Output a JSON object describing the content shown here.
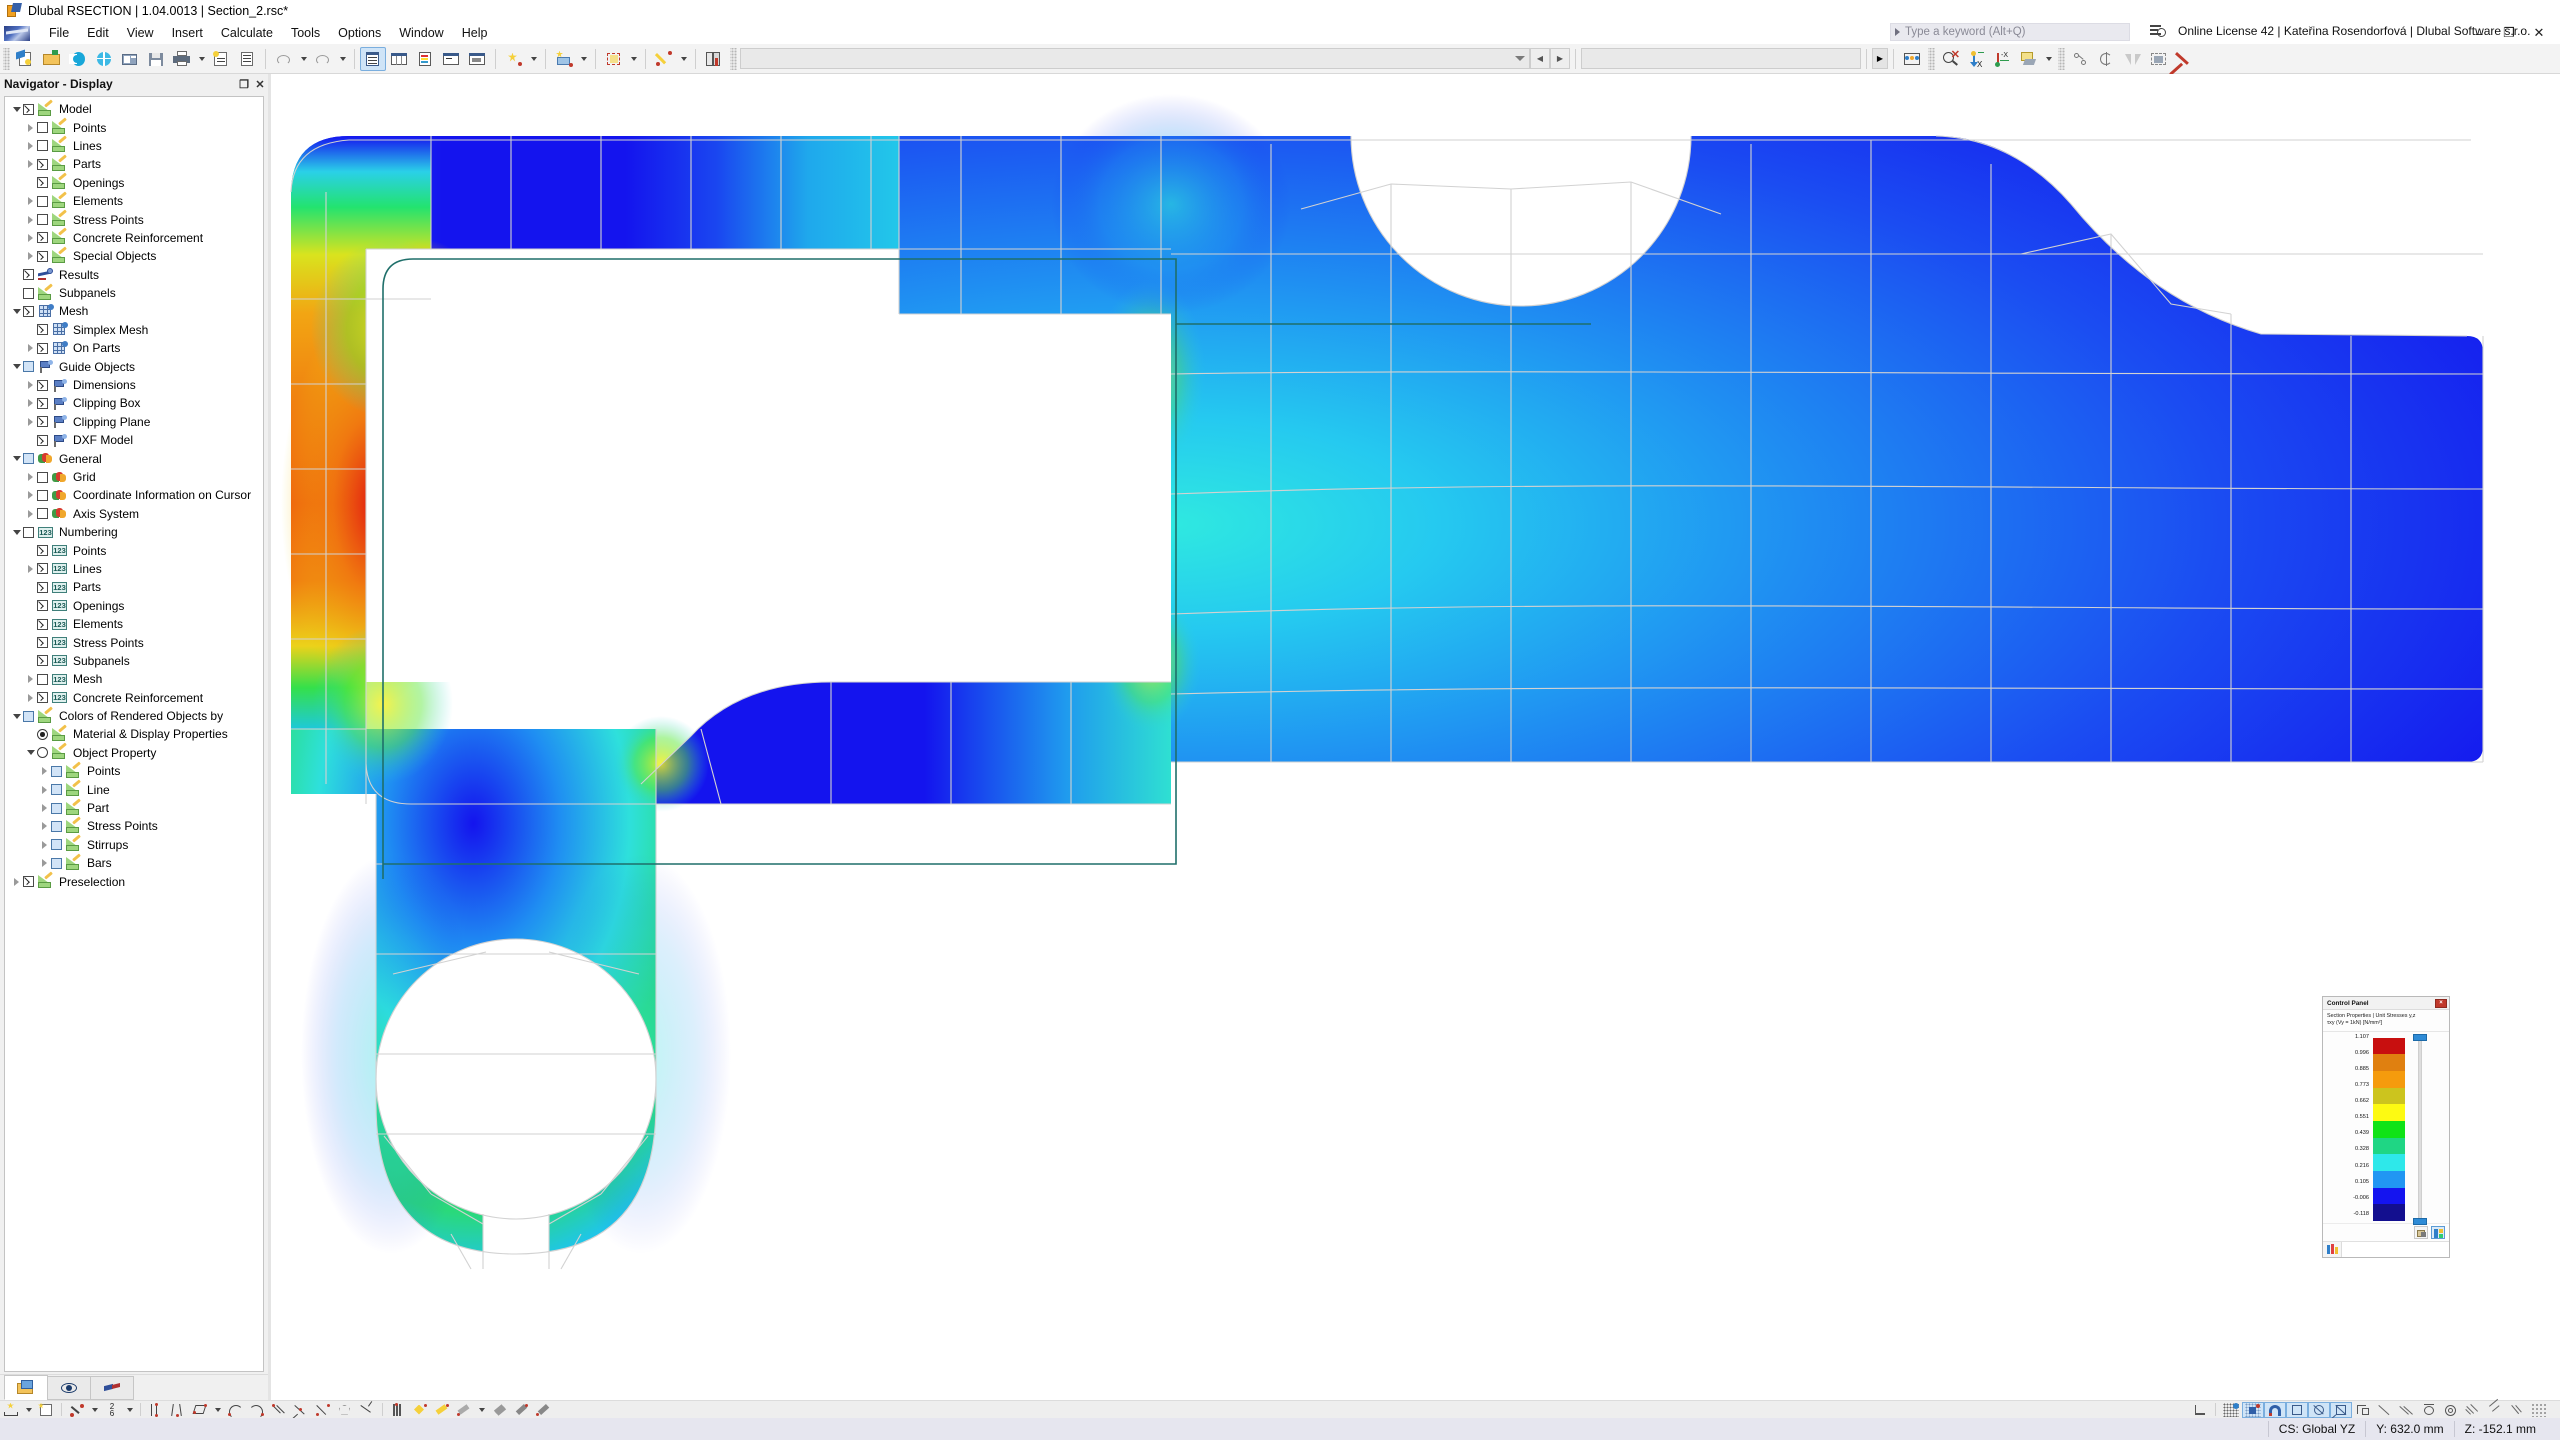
{
  "window": {
    "title": "Dlubal RSECTION | 1.04.0013 | Section_2.rsc*",
    "app_icon": "rsection-app-icon",
    "minimize": "–",
    "restore": "❐",
    "close": "✕"
  },
  "menu": {
    "logo": "dlubal-logo",
    "items": [
      {
        "label": "File"
      },
      {
        "label": "Edit"
      },
      {
        "label": "View"
      },
      {
        "label": "Insert"
      },
      {
        "label": "Calculate"
      },
      {
        "label": "Tools"
      },
      {
        "label": "Options"
      },
      {
        "label": "Window"
      },
      {
        "label": "Help"
      }
    ]
  },
  "search": {
    "placeholder": "Type a keyword (Alt+Q)",
    "value": ""
  },
  "license": {
    "text": "Online License 42 | Kateřina Rosendorfová | Dlubal Software s.r.o.",
    "icon": "license-list-search-icon"
  },
  "navigator": {
    "title": "Navigator - Display",
    "undock_label": "❐",
    "close_label": "✕",
    "tree": [
      {
        "label": "Model",
        "indent": 0,
        "chev": "down",
        "ctrl": "check-on",
        "icon": "ruler"
      },
      {
        "label": "Points",
        "indent": 1,
        "chev": "right",
        "ctrl": "check-off",
        "icon": "ruler"
      },
      {
        "label": "Lines",
        "indent": 1,
        "chev": "right",
        "ctrl": "check-off",
        "icon": "ruler"
      },
      {
        "label": "Parts",
        "indent": 1,
        "chev": "right",
        "ctrl": "check-on",
        "icon": "ruler"
      },
      {
        "label": "Openings",
        "indent": 1,
        "chev": "none",
        "ctrl": "check-on",
        "icon": "ruler"
      },
      {
        "label": "Elements",
        "indent": 1,
        "chev": "right",
        "ctrl": "check-off",
        "icon": "ruler"
      },
      {
        "label": "Stress Points",
        "indent": 1,
        "chev": "right",
        "ctrl": "check-off",
        "icon": "ruler"
      },
      {
        "label": "Concrete Reinforcement",
        "indent": 1,
        "chev": "right",
        "ctrl": "check-on",
        "icon": "ruler"
      },
      {
        "label": "Special Objects",
        "indent": 1,
        "chev": "right",
        "ctrl": "check-on",
        "icon": "ruler"
      },
      {
        "label": "Results",
        "indent": 0,
        "chev": "none",
        "ctrl": "check-on",
        "icon": "results"
      },
      {
        "label": "Subpanels",
        "indent": 0,
        "chev": "none",
        "ctrl": "check-off",
        "icon": "ruler"
      },
      {
        "label": "Mesh",
        "indent": 0,
        "chev": "down",
        "ctrl": "check-on",
        "icon": "mesh"
      },
      {
        "label": "Simplex Mesh",
        "indent": 1,
        "chev": "none",
        "ctrl": "check-on",
        "icon": "mesh"
      },
      {
        "label": "On Parts",
        "indent": 1,
        "chev": "right",
        "ctrl": "check-on",
        "icon": "mesh"
      },
      {
        "label": "Guide Objects",
        "indent": 0,
        "chev": "down",
        "ctrl": "check-blue",
        "icon": "guide"
      },
      {
        "label": "Dimensions",
        "indent": 1,
        "chev": "right",
        "ctrl": "check-on",
        "icon": "guide"
      },
      {
        "label": "Clipping Box",
        "indent": 1,
        "chev": "right",
        "ctrl": "check-on",
        "icon": "guide"
      },
      {
        "label": "Clipping Plane",
        "indent": 1,
        "chev": "right",
        "ctrl": "check-on",
        "icon": "guide"
      },
      {
        "label": "DXF Model",
        "indent": 1,
        "chev": "none",
        "ctrl": "check-on",
        "icon": "guide"
      },
      {
        "label": "General",
        "indent": 0,
        "chev": "down",
        "ctrl": "check-blue",
        "icon": "general"
      },
      {
        "label": "Grid",
        "indent": 1,
        "chev": "right",
        "ctrl": "check-off",
        "icon": "general"
      },
      {
        "label": "Coordinate Information on Cursor",
        "indent": 1,
        "chev": "right",
        "ctrl": "check-off",
        "icon": "general"
      },
      {
        "label": "Axis System",
        "indent": 1,
        "chev": "right",
        "ctrl": "check-off",
        "icon": "general"
      },
      {
        "label": "Numbering",
        "indent": 0,
        "chev": "down",
        "ctrl": "check-off",
        "icon": "numbering"
      },
      {
        "label": "Points",
        "indent": 1,
        "chev": "none",
        "ctrl": "check-on",
        "icon": "numbering"
      },
      {
        "label": "Lines",
        "indent": 1,
        "chev": "right",
        "ctrl": "check-on",
        "icon": "numbering"
      },
      {
        "label": "Parts",
        "indent": 1,
        "chev": "none",
        "ctrl": "check-on",
        "icon": "numbering"
      },
      {
        "label": "Openings",
        "indent": 1,
        "chev": "none",
        "ctrl": "check-on",
        "icon": "numbering"
      },
      {
        "label": "Elements",
        "indent": 1,
        "chev": "none",
        "ctrl": "check-on",
        "icon": "numbering"
      },
      {
        "label": "Stress Points",
        "indent": 1,
        "chev": "none",
        "ctrl": "check-on",
        "icon": "numbering"
      },
      {
        "label": "Subpanels",
        "indent": 1,
        "chev": "none",
        "ctrl": "check-on",
        "icon": "numbering"
      },
      {
        "label": "Mesh",
        "indent": 1,
        "chev": "right",
        "ctrl": "check-off",
        "icon": "numbering"
      },
      {
        "label": "Concrete Reinforcement",
        "indent": 1,
        "chev": "right",
        "ctrl": "check-on",
        "icon": "numbering"
      },
      {
        "label": "Colors of Rendered Objects by",
        "indent": 0,
        "chev": "down",
        "ctrl": "check-blue",
        "icon": "ruler"
      },
      {
        "label": "Material & Display Properties",
        "indent": 1,
        "chev": "none",
        "ctrl": "radio-on",
        "icon": "ruler"
      },
      {
        "label": "Object Property",
        "indent": 1,
        "chev": "down",
        "ctrl": "radio-off",
        "icon": "ruler"
      },
      {
        "label": "Points",
        "indent": 2,
        "chev": "right",
        "ctrl": "check-blue",
        "icon": "ruler"
      },
      {
        "label": "Line",
        "indent": 2,
        "chev": "right",
        "ctrl": "check-blue",
        "icon": "ruler"
      },
      {
        "label": "Part",
        "indent": 2,
        "chev": "right",
        "ctrl": "check-blue",
        "icon": "ruler"
      },
      {
        "label": "Stress Points",
        "indent": 2,
        "chev": "right",
        "ctrl": "check-blue",
        "icon": "ruler"
      },
      {
        "label": "Stirrups",
        "indent": 2,
        "chev": "right",
        "ctrl": "check-blue",
        "icon": "ruler"
      },
      {
        "label": "Bars",
        "indent": 2,
        "chev": "right",
        "ctrl": "check-blue",
        "icon": "ruler"
      },
      {
        "label": "Preselection",
        "indent": 0,
        "chev": "right",
        "ctrl": "check-on",
        "icon": "ruler"
      }
    ],
    "tabs": [
      {
        "name": "project-navigator-tab",
        "icon": "folder-open-icon",
        "selected": true
      },
      {
        "name": "display-navigator-tab",
        "icon": "eye-icon",
        "selected": false
      },
      {
        "name": "results-navigator-tab",
        "icon": "wedge-icon",
        "selected": false
      }
    ]
  },
  "control_panel": {
    "title": "Control Panel",
    "close_label": "×",
    "subtitle_line1": "Section Properties | Unit Stresses y,z",
    "subtitle_line2": "τxy (Vy =  1kN) [N/mm²]",
    "legend": {
      "labels": [
        "1.107",
        "0.996",
        "0.885",
        "0.773",
        "0.662",
        "0.551",
        "0.439",
        "0.328",
        "0.216",
        "0.105",
        "-0.006",
        "-0.118"
      ],
      "colors": [
        "#c80f0f",
        "#e08010",
        "#f59b0d",
        "#ccc41e",
        "#fdfa12",
        "#10e317",
        "#1fd684",
        "#2ee8ea",
        "#2196f3",
        "#1414f0",
        "#130f8f"
      ]
    },
    "slider": {
      "knob_color": "#2e8bd6",
      "track_color": "#dedede"
    },
    "footer_buttons": [
      {
        "name": "panel-settings-button",
        "icon": "panel-config-icon",
        "selected": false
      },
      {
        "name": "panel-colors-button",
        "icon": "color-scale-icon",
        "selected": true
      }
    ],
    "bottom_tab": {
      "name": "color-scale-tab",
      "icon": "color-bars-icon"
    }
  },
  "toolbar": {
    "groups": [
      {
        "name": "file-group",
        "buttons": [
          {
            "name": "new-model-button",
            "icon": "new-document-icon"
          },
          {
            "name": "open-button",
            "icon": "open-folder-icon"
          },
          {
            "name": "import-rfem-button",
            "icon": "blue-c-icon"
          },
          {
            "name": "open-web-button",
            "icon": "globe-icon"
          },
          {
            "name": "print-preview-button",
            "icon": "print-preview-icon"
          },
          {
            "name": "save-button",
            "icon": "floppy-save-icon"
          },
          {
            "name": "print-button",
            "icon": "printer-icon",
            "dropdown": true
          },
          {
            "name": "printout-report-button",
            "icon": "report-icon"
          },
          {
            "name": "document-button",
            "icon": "page-icon"
          }
        ]
      },
      {
        "name": "undo-redo-group",
        "buttons": [
          {
            "name": "undo-button",
            "icon": "undo-arrow-icon",
            "dropdown": true
          },
          {
            "name": "redo-button",
            "icon": "redo-arrow-icon",
            "dropdown": true
          }
        ]
      },
      {
        "name": "tables-group",
        "buttons": [
          {
            "name": "navigator-toggle-button",
            "icon": "navigator-panel-icon",
            "active": true
          },
          {
            "name": "tables-toggle-button",
            "icon": "table-grid-icon"
          },
          {
            "name": "panel-toggle-button",
            "icon": "color-panel-icon"
          },
          {
            "name": "console-button",
            "icon": "console-icon"
          },
          {
            "name": "script-button",
            "icon": "script-icon"
          }
        ]
      },
      {
        "name": "insert-group",
        "buttons": [
          {
            "name": "new-point-button",
            "icon": "point-star-icon",
            "dropdown": true
          },
          {
            "name": "new-line-button",
            "icon": "line-star-icon",
            "dropdown": true
          },
          {
            "name": "new-part-button",
            "icon": "part-star-icon",
            "dropdown": true
          },
          {
            "name": "new-opening-button",
            "icon": "opening-star-icon",
            "dropdown": true
          },
          {
            "name": "new-stresspoint-button",
            "icon": "stresspoint-star-icon",
            "dropdown": true
          },
          {
            "name": "material-library-button",
            "icon": "library-book-icon"
          }
        ]
      },
      {
        "name": "view-group",
        "buttons": [
          {
            "name": "zoom-reset-button",
            "icon": "zoom-cancel-icon"
          },
          {
            "name": "view-zx-button",
            "icon": "axis-zx-icon"
          },
          {
            "name": "view-x-button",
            "icon": "axis-x-icon"
          },
          {
            "name": "render-mode-button",
            "icon": "render-mode-icon",
            "dropdown": true
          }
        ]
      },
      {
        "name": "modify-group",
        "buttons": [
          {
            "name": "move-copy-button",
            "icon": "move-copy-icon"
          },
          {
            "name": "rotate-button",
            "icon": "rotate-icon"
          },
          {
            "name": "mirror-button",
            "icon": "mirror-icon"
          },
          {
            "name": "scale-button",
            "icon": "scale-icon"
          },
          {
            "name": "delete-button",
            "icon": "red-x-delete-icon"
          }
        ]
      }
    ],
    "selection_combo": {
      "value": "",
      "placeholder": ""
    },
    "page_prev": "◀",
    "page_next": "▶"
  },
  "bottom_toolbar": {
    "left_buttons": [
      {
        "name": "dimension-button",
        "icon": "dimension-icon",
        "dropdown": true
      },
      {
        "name": "snap-settings-button",
        "icon": "snap-settings-icon"
      },
      {
        "name": "point-snap-button",
        "icon": "point-snap-icon",
        "dropdown": true
      },
      {
        "name": "fraction-button",
        "icon": "fraction-2-6-icon",
        "dropdown": true
      },
      {
        "name": "parallel-lines-button",
        "icon": "parallel-lines-icon"
      },
      {
        "name": "converging-lines-button",
        "icon": "converging-lines-icon"
      },
      {
        "name": "rhombus-button",
        "icon": "rhombus-icon",
        "dropdown": true
      },
      {
        "name": "arc-up-button",
        "icon": "arc-up-icon"
      },
      {
        "name": "arc-down-button",
        "icon": "arc-down-icon"
      },
      {
        "name": "parallel-offset-button",
        "icon": "parallel-offset-icon"
      },
      {
        "name": "intersect-button",
        "icon": "intersect-icon"
      },
      {
        "name": "tangent-button",
        "icon": "tangent-icon"
      },
      {
        "name": "polygon-button",
        "icon": "polygon-icon"
      },
      {
        "name": "perpendicular-button",
        "icon": "perpendicular-icon"
      },
      {
        "name": "stripes-button",
        "icon": "stripes-icon"
      },
      {
        "name": "yellow-diamond-button",
        "icon": "yellow-diamond-icon"
      },
      {
        "name": "yellow-wand-button",
        "icon": "yellow-wand-icon"
      },
      {
        "name": "slope-button",
        "icon": "slope-icon",
        "dropdown": true
      },
      {
        "name": "double-line-button",
        "icon": "double-line-icon"
      },
      {
        "name": "thick-line-button",
        "icon": "thick-line-icon"
      },
      {
        "name": "thick-line2-button",
        "icon": "thick-line-2-icon"
      }
    ],
    "right_buttons": [
      {
        "name": "origin-button",
        "icon": "origin-corner-icon",
        "on": false
      },
      {
        "name": "grid-snap-button",
        "icon": "grid-snap-icon",
        "on": false
      },
      {
        "name": "object-snap-button",
        "icon": "object-snap-icon",
        "on": true
      },
      {
        "name": "magnet-snap-button",
        "icon": "magnet-icon",
        "on": true
      },
      {
        "name": "plane-button",
        "icon": "square-plane-icon",
        "on": true
      },
      {
        "name": "cross-square-button",
        "icon": "cross-square-icon",
        "on": true
      },
      {
        "name": "boxed-x-button",
        "icon": "boxed-x-icon",
        "on": true
      },
      {
        "name": "corner-button",
        "icon": "corner-icon",
        "on": false
      },
      {
        "name": "pen-button",
        "icon": "pen-icon",
        "on": false
      },
      {
        "name": "parallel-button",
        "icon": "parallel-icon",
        "on": false
      },
      {
        "name": "circle-top-button",
        "icon": "circle-top-icon",
        "on": false
      },
      {
        "name": "circle-hatch-button",
        "icon": "circle-hatch-icon",
        "on": false
      },
      {
        "name": "rays-button",
        "icon": "rays-icon",
        "on": false
      },
      {
        "name": "rays2-button",
        "icon": "rays-2-icon",
        "on": false
      },
      {
        "name": "rays3-button",
        "icon": "rays-3-icon",
        "on": false
      },
      {
        "name": "dots-button",
        "icon": "dots-icon",
        "on": false
      }
    ]
  },
  "status_bar": {
    "cs_label": "CS: Global YZ",
    "y_label": "Y: 632.0 mm",
    "z_label": "Z: -152.1 mm"
  },
  "viewport": {
    "name": "model-viewport",
    "background": "#ffffff",
    "mesh_line_color": "#d4d4d4",
    "outline_color": "#1f6f6a"
  }
}
